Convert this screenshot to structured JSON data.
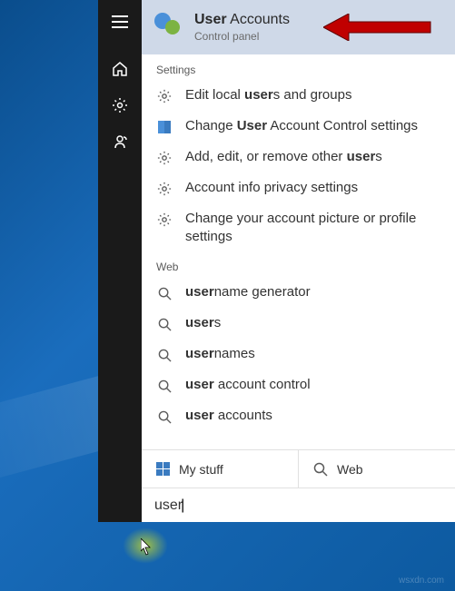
{
  "top_result": {
    "title_bold": "User",
    "title_rest": " Accounts",
    "subtitle": "Control panel"
  },
  "sections": {
    "settings": "Settings",
    "web": "Web"
  },
  "settings_items": [
    {
      "pre": "Edit local ",
      "bold": "user",
      "post": "s and groups"
    },
    {
      "pre": "Change ",
      "bold": "User",
      "post": " Account Control settings"
    },
    {
      "pre": "Add, edit, or remove other ",
      "bold": "user",
      "post": "s"
    },
    {
      "pre": "Account info privacy settings",
      "bold": "",
      "post": ""
    },
    {
      "pre": "Change your account picture or profile settings",
      "bold": "",
      "post": ""
    }
  ],
  "web_items": [
    {
      "bold": "user",
      "post": "name generator"
    },
    {
      "bold": "user",
      "post": "s"
    },
    {
      "bold": "user",
      "post": "names"
    },
    {
      "bold": "user",
      "post": " account control"
    },
    {
      "bold": "user",
      "post": " accounts"
    }
  ],
  "tabs": {
    "mystuff": "My stuff",
    "web": "Web"
  },
  "search_query": "user",
  "watermark": "wsxdn.com"
}
